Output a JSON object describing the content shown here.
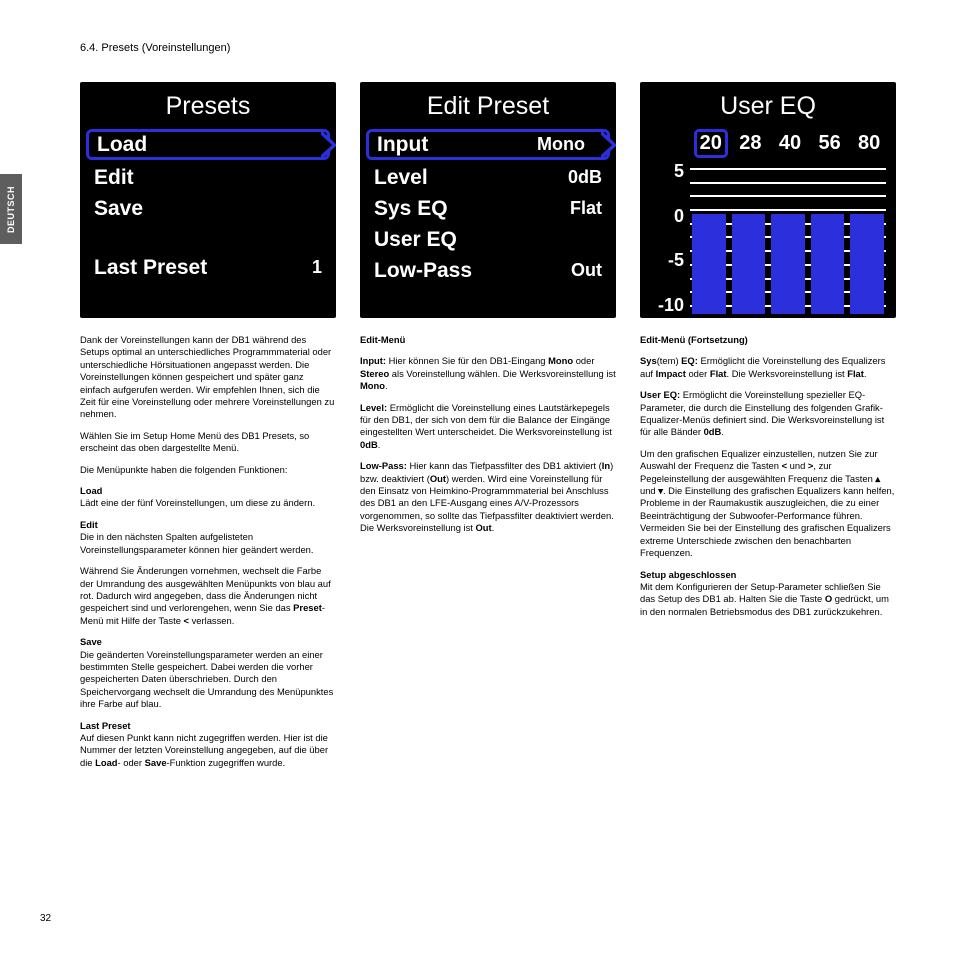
{
  "language_tab": "DEUTSCH",
  "section": "6.4. Presets (Voreinstellungen)",
  "page_number": "32",
  "screen_presets": {
    "title": "Presets",
    "load": "Load",
    "edit": "Edit",
    "save": "Save",
    "last_preset_label": "Last Preset",
    "last_preset_value": "1"
  },
  "screen_edit": {
    "title": "Edit Preset",
    "input_label": "Input",
    "input_value": "Mono",
    "level_label": "Level",
    "level_value": "0dB",
    "syseq_label": "Sys EQ",
    "syseq_value": "Flat",
    "usereq_label": "User EQ",
    "lowpass_label": "Low-Pass",
    "lowpass_value": "Out"
  },
  "screen_usereq": {
    "title": "User EQ",
    "freqs": {
      "f0": "20",
      "f1": "28",
      "f2": "40",
      "f3": "56",
      "f4": "80"
    },
    "ylabels": {
      "y0": "5",
      "y1": "0",
      "y2": "-5",
      "y3": "-10"
    }
  },
  "col1": {
    "p1": "Dank der Voreinstellungen kann der DB1 während des Setups optimal an unterschiedliches Programmmaterial oder unterschiedliche Hörsituationen angepasst werden. Die Voreinstellungen können gespeichert und später ganz einfach aufgerufen werden. Wir empfehlen Ihnen, sich die Zeit für eine Voreinstellung oder mehrere Voreinstellungen zu nehmen.",
    "p2": "Wählen Sie im Setup Home Menü des DB1 Presets, so erscheint das oben dargestellte Menü.",
    "p3": "Die Menüpunkte haben die folgenden Funktionen:",
    "load_h": "Load",
    "load_t": "Lädt eine der fünf Voreinstellungen, um diese zu ändern.",
    "edit_h": "Edit",
    "edit_t": "Die in den nächsten Spalten aufgelisteten Voreinstellungsparameter können hier geändert werden.",
    "p4a": "Während Sie Änderungen vornehmen, wechselt die Farbe der Umrandung des ausgewählten Menüpunkts von blau auf rot. Dadurch wird angegeben, dass die Änderungen nicht gespeichert sind und verlorengehen, wenn Sie das ",
    "p4b": "Preset",
    "p4c": "-Menü mit Hilfe der Taste ",
    "p4d": " verlassen.",
    "save_h": "Save",
    "save_t": "Die geänderten Voreinstellungsparameter werden an einer bestimmten Stelle gespeichert. Dabei werden die vorher gespeicherten Daten überschrieben. Durch den Speichervorgang wechselt die Umrandung des Menüpunktes ihre Farbe auf blau.",
    "last_h": "Last Preset",
    "last_t1": "Auf diesen Punkt kann nicht zugegriffen werden. Hier ist die Nummer der letzten Voreinstellung angegeben, auf die über die ",
    "last_b1": "Load",
    "last_t2": "- oder ",
    "last_b2": "Save",
    "last_t3": "-Funktion zugegriffen wurde."
  },
  "col2": {
    "h": "Edit-Menü",
    "input_b": "Input:",
    "input_t1": " Hier können Sie für den DB1-Eingang ",
    "input_b2": "Mono",
    "input_t2": " oder ",
    "input_b3": "Stereo",
    "input_t3": " als Voreinstellung wählen. Die Werksvoreinstellung ist ",
    "input_b4": "Mono",
    "input_t4": ".",
    "level_b": "Level:",
    "level_t1": " Ermöglicht die Voreinstellung eines Lautstärkepegels für den DB1, der sich von dem für die Balance der Eingänge eingestellten Wert unterscheidet. Die Werksvoreinstellung ist ",
    "level_b2": "0dB",
    "level_t2": ".",
    "lp_b": "Low-Pass:",
    "lp_t1": " Hier kann das Tiefpassfilter des DB1 aktiviert (",
    "lp_b2": "In",
    "lp_t2": ") bzw. deaktiviert (",
    "lp_b3": "Out",
    "lp_t3": ") werden. Wird eine Voreinstellung für den Einsatz von Heimkino-Programmmaterial bei Anschluss des DB1 an den LFE-Ausgang eines A/V-Prozessors vorgenommen, so sollte das Tiefpassfilter deaktiviert werden. Die Werksvoreinstellung ist ",
    "lp_b4": "Out",
    "lp_t4": "."
  },
  "col3": {
    "h": "Edit-Menü (Fortsetzung)",
    "sys_b": "Sys",
    "sys_t0": "(tem) ",
    "sys_b2": "EQ:",
    "sys_t1": " Ermöglicht die Voreinstellung des Equalizers auf ",
    "sys_b3": "Impact",
    "sys_t2": " oder ",
    "sys_b4": "Flat",
    "sys_t3": ". Die Werksvoreinstellung ist ",
    "sys_b5": "Flat",
    "sys_t4": ".",
    "ueq_b": "User EQ:",
    "ueq_t1": " Ermöglicht die Voreinstellung spezieller EQ-Parameter, die durch die Einstellung des folgenden Grafik-Equalizer-Menüs definiert sind. Die Werksvoreinstellung ist für alle Bänder ",
    "ueq_b2": "0dB",
    "ueq_t2": ".",
    "p3a": "Um den grafischen Equalizer einzustellen, nutzen Sie zur Auswahl der Frequenz die Tasten ",
    "p3b": " und ",
    "p3c": ", zur Pegeleinstellung der ausgewählten Frequenz die Tasten ",
    "p3d": " und ",
    "p3e": ". Die Einstellung des grafischen Equalizers kann helfen, Probleme in der Raumakustik auszugleichen, die zu einer Beeinträchtigung der Subwoofer-Performance führen. Vermeiden Sie bei der Einstellung des grafischen Equalizers extreme Unterschiede zwischen den benachbarten Frequenzen.",
    "setup_h": "Setup abgeschlossen",
    "setup_t1": "Mit dem Konfigurieren der Setup-Parameter schließen Sie das Setup des DB1 ab. Halten Sie die Taste ",
    "setup_b": "O",
    "setup_t2": " gedrückt, um in den normalen Betriebsmodus des DB1 zurückzukehren."
  },
  "icons": {
    "left": "<",
    "right": ">",
    "up": "▴",
    "down": "▾"
  }
}
